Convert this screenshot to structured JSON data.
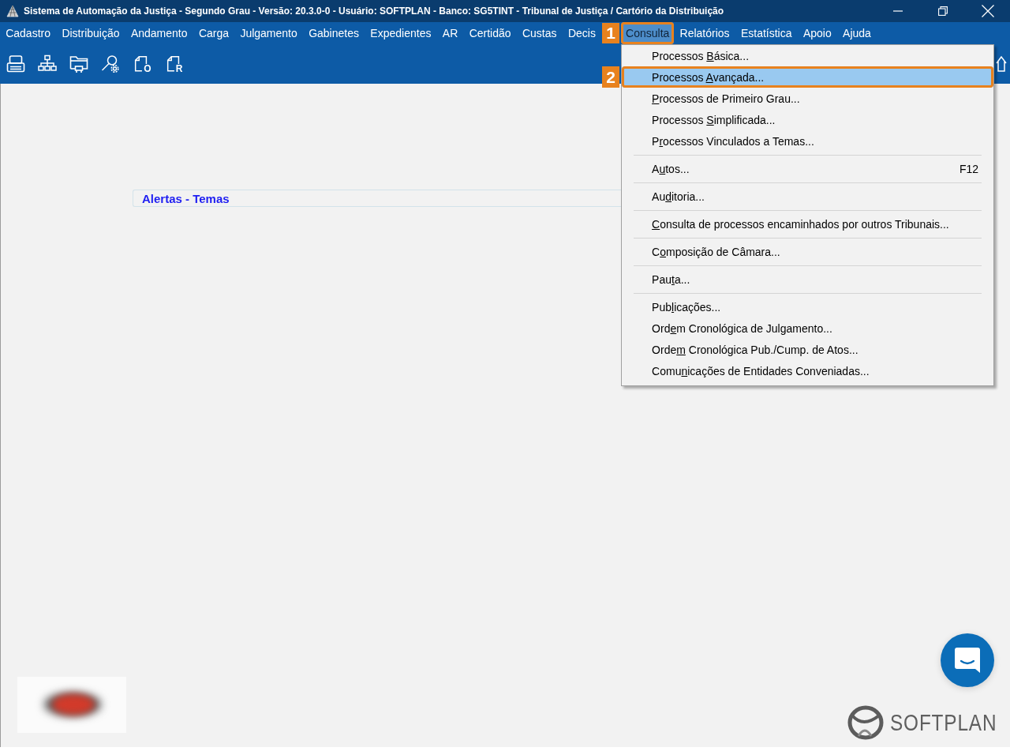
{
  "window": {
    "title": "Sistema de Automação da Justiça - Segundo Grau - Versão: 20.3.0-0 - Usuário: SOFTPLAN - Banco: SG5TINT - Tribunal de Justiça / Cartório da Distribuição"
  },
  "menu_bar": [
    {
      "label": "Cadastro",
      "selected": false
    },
    {
      "label": "Distribuição",
      "selected": false
    },
    {
      "label": "Andamento",
      "selected": false
    },
    {
      "label": "Carga",
      "selected": false
    },
    {
      "label": "Julgamento",
      "selected": false
    },
    {
      "label": "Gabinetes",
      "selected": false
    },
    {
      "label": "Expedientes",
      "selected": false
    },
    {
      "label": "AR",
      "selected": false
    },
    {
      "label": "Certidão",
      "selected": false
    },
    {
      "label": "Custas",
      "selected": false
    },
    {
      "label": "Decis",
      "selected": false
    },
    {
      "label": "Consulta",
      "selected": true,
      "callout": "1"
    },
    {
      "label": "Relatórios",
      "selected": false
    },
    {
      "label": "Estatística",
      "selected": false
    },
    {
      "label": "Apoio",
      "selected": false
    },
    {
      "label": "Ajuda",
      "selected": false
    }
  ],
  "toolbar": [
    {
      "kind": "tray"
    },
    {
      "kind": "hierarchy"
    },
    {
      "kind": "folder"
    },
    {
      "kind": "search-settings"
    },
    {
      "kind": "document",
      "letter": "O"
    },
    {
      "kind": "document",
      "letter": "R"
    }
  ],
  "dropdown": {
    "items": [
      {
        "kind": "item",
        "text_before": "Processos ",
        "access_key": "B",
        "text_after": "ásica...",
        "selected": false
      },
      {
        "kind": "item",
        "text_before": "Processos ",
        "access_key": "A",
        "text_after": "vançada...",
        "selected": true,
        "callout": "2"
      },
      {
        "kind": "item",
        "access_key": "P",
        "text_after": "rocessos de Primeiro Grau...",
        "selected": false
      },
      {
        "kind": "item",
        "text_before": "Processos ",
        "access_key": "S",
        "text_after": "implificada...",
        "selected": false
      },
      {
        "kind": "item",
        "text_before": "P",
        "access_key": "r",
        "text_after": "ocessos Vinculados a Temas...",
        "selected": false
      },
      {
        "kind": "separator"
      },
      {
        "kind": "item",
        "text_before": "A",
        "access_key": "u",
        "text_after": "tos...",
        "shortcut": "F12",
        "selected": false
      },
      {
        "kind": "separator"
      },
      {
        "kind": "item",
        "text_before": "Au",
        "access_key": "d",
        "text_after": "itoria...",
        "selected": false
      },
      {
        "kind": "separator"
      },
      {
        "kind": "item",
        "access_key": "C",
        "text_after": "onsulta de processos encaminhados por outros Tribunais...",
        "selected": false
      },
      {
        "kind": "separator"
      },
      {
        "kind": "item",
        "text_before": "C",
        "access_key": "o",
        "text_after": "mposição de Câmara...",
        "selected": false
      },
      {
        "kind": "separator"
      },
      {
        "kind": "item",
        "text_before": "Pau",
        "access_key": "t",
        "text_after": "a...",
        "selected": false
      },
      {
        "kind": "separator"
      },
      {
        "kind": "item",
        "text_before": "Pub",
        "access_key": "l",
        "text_after": "icações...",
        "selected": false
      },
      {
        "kind": "item",
        "text_before": "Ord",
        "access_key": "e",
        "text_after": "m Cronológica de Julgamento...",
        "selected": false
      },
      {
        "kind": "item",
        "text_before": "Orde",
        "access_key": "m",
        "text_after": " Cronológica Pub./Cump. de Atos...",
        "selected": false
      },
      {
        "kind": "item",
        "text_before": "Comu",
        "access_key": "n",
        "text_after": "icações de Entidades Conveniadas...",
        "selected": false
      }
    ]
  },
  "alerts_panel": {
    "title": "Alertas - Temas"
  },
  "footer": {
    "brand": "SOFTPLAN"
  }
}
